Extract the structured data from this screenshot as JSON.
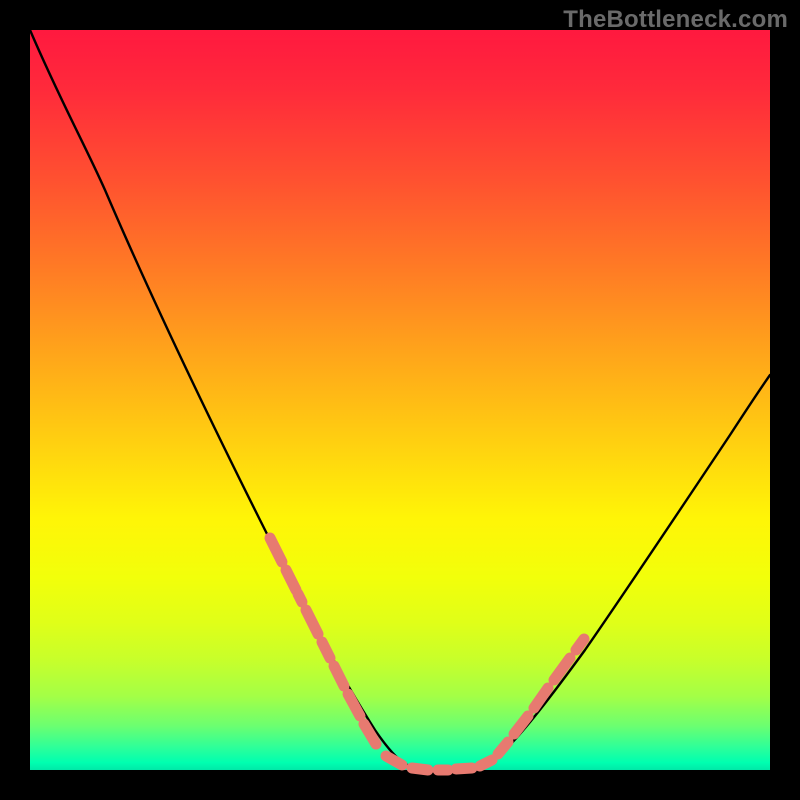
{
  "watermark": "TheBottleneck.com",
  "colors": {
    "background": "#000000",
    "curve": "#000000",
    "highlight": "#e77a70",
    "gradient_top": "#ff193f",
    "gradient_bottom": "#00e8a8"
  },
  "chart_data": {
    "type": "line",
    "title": "",
    "xlabel": "",
    "ylabel": "",
    "xlim": [
      0,
      100
    ],
    "ylim": [
      0,
      100
    ],
    "grid": false,
    "legend": false,
    "note": "Bottleneck-style V-curve on rainbow gradient background. Values are percentages read from vertical position (0 at bottom / green, 100 at top / red).",
    "series": [
      {
        "name": "curve",
        "x": [
          0,
          5,
          10,
          15,
          20,
          25,
          30,
          35,
          40,
          45,
          48,
          50,
          52,
          55,
          58,
          60,
          62,
          65,
          70,
          75,
          80,
          85,
          90,
          95,
          100
        ],
        "y": [
          100,
          92,
          83,
          73,
          62,
          51,
          40,
          28,
          16,
          6,
          2,
          0,
          0,
          0,
          0,
          0,
          1,
          3,
          8,
          15,
          23,
          32,
          42,
          52,
          62
        ]
      }
    ],
    "highlighted_regions": [
      {
        "description": "lower-left descending segment with salmon dashes",
        "x_range": [
          32,
          48
        ],
        "y_range": [
          2,
          24
        ]
      },
      {
        "description": "lower-right ascending segment with salmon dashes",
        "x_range": [
          62,
          74
        ],
        "y_range": [
          1,
          14
        ]
      },
      {
        "description": "valley segments with salmon dashes",
        "x_range": [
          48,
          62
        ],
        "y_range": [
          0,
          2
        ]
      }
    ]
  }
}
